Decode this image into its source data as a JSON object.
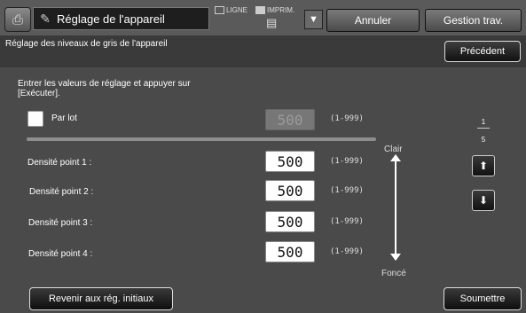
{
  "header": {
    "logo_icon": "copier-icon",
    "title_icon": "tools-icon",
    "title": "Réglage de l'appareil",
    "mode_ligne": "LIGNE",
    "mode_imprim": "IMPRIM.",
    "cancel_label": "Annuler",
    "job_label": "Gestion trav."
  },
  "subheader": {
    "title": "Réglage des niveaux de gris de l'appareil",
    "prev_label": "Précédent"
  },
  "main": {
    "instruction": "Entrer les valeurs de réglage et appuyer sur [Exécuter].",
    "batch": {
      "label": "Par lot",
      "value": "500",
      "range": "(1-999)",
      "checked": false
    },
    "rows": [
      {
        "label": "Densité point 1 :",
        "value": "500",
        "range": "(1-999)"
      },
      {
        "label": "Densité point 2 :",
        "value": "500",
        "range": "(1-999)"
      },
      {
        "label": "Densité point 3 :",
        "value": "500",
        "range": "(1-999)"
      },
      {
        "label": "Densité point 4 :",
        "value": "500",
        "range": "(1-999)"
      }
    ],
    "scale": {
      "top_label": "Clair",
      "bottom_label": "Foncé"
    },
    "pager": {
      "current": "1",
      "total": "5"
    }
  },
  "footer": {
    "reset_label": "Revenir aux rég. initiaux",
    "submit_label": "Soumettre"
  }
}
